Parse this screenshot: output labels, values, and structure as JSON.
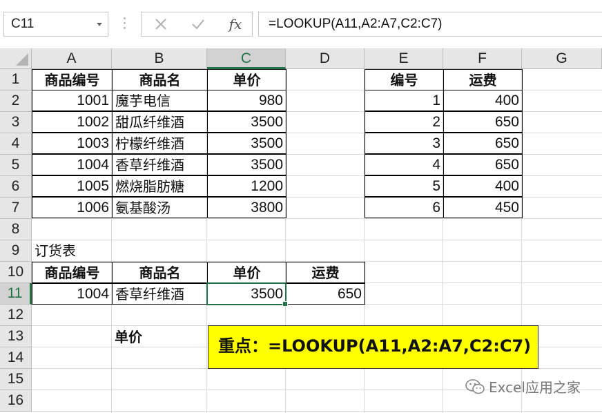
{
  "name_box": {
    "value": "C11"
  },
  "formula_bar": {
    "cancel_icon": "close-icon",
    "enter_icon": "check-icon",
    "fx_label": "fx",
    "formula": "=LOOKUP(A11,A2:A7,C2:C7)"
  },
  "columns": [
    "A",
    "B",
    "C",
    "D",
    "E",
    "F",
    "G"
  ],
  "rows": [
    "1",
    "2",
    "3",
    "4",
    "5",
    "6",
    "7",
    "8",
    "9",
    "10",
    "11",
    "12",
    "13",
    "14",
    "15",
    "16"
  ],
  "products": {
    "headers": [
      "商品编号",
      "商品名",
      "单价"
    ],
    "rows": [
      [
        "1001",
        "魔芋电信",
        "980"
      ],
      [
        "1002",
        "甜瓜纤维酒",
        "3500"
      ],
      [
        "1003",
        "柠檬纤维酒",
        "3500"
      ],
      [
        "1004",
        "香草纤维酒",
        "3500"
      ],
      [
        "1005",
        "燃烧脂肪糖",
        "1200"
      ],
      [
        "1006",
        "氨基酸汤",
        "3800"
      ]
    ]
  },
  "shipping": {
    "headers": [
      "编号",
      "运费"
    ],
    "rows": [
      [
        "1",
        "400"
      ],
      [
        "2",
        "650"
      ],
      [
        "3",
        "650"
      ],
      [
        "4",
        "650"
      ],
      [
        "5",
        "400"
      ],
      [
        "6",
        "450"
      ]
    ]
  },
  "order": {
    "title": "订货表",
    "headers": [
      "商品编号",
      "商品名",
      "单价",
      "运费"
    ],
    "row": [
      "1004",
      "香草纤维酒",
      "3500",
      "650"
    ]
  },
  "row13_label": "单价",
  "callout": {
    "text": "重点：=LOOKUP(A11,A2:A7,C2:C7)",
    "color": "#ffff00"
  },
  "watermark": {
    "text": "Excel应用之家",
    "icon": "wechat-icon"
  },
  "colors": {
    "selection": "#217346",
    "header_bg": "#e6e6e6",
    "gridline": "#d9d9d9"
  }
}
